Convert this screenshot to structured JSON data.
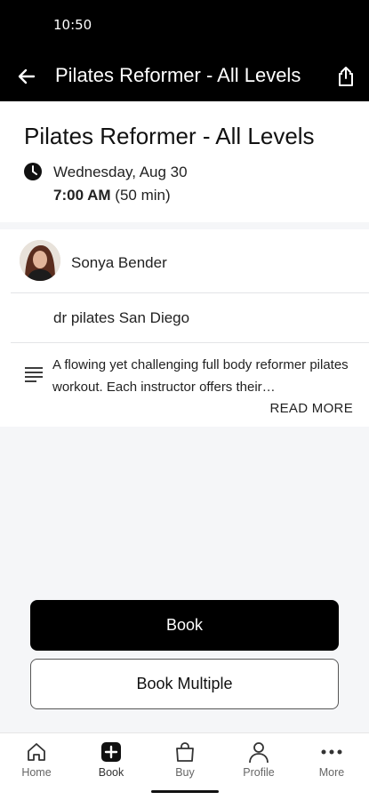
{
  "status_bar": {
    "time": "10:50"
  },
  "app_bar": {
    "title": "Pilates Reformer - All Levels",
    "back_icon": "arrow-left-icon",
    "share_icon": "share-icon"
  },
  "class": {
    "title": "Pilates Reformer - All Levels",
    "date": "Wednesday, Aug 30",
    "start_time": "7:00 AM",
    "duration": "(50 min)"
  },
  "instructor": {
    "name": "Sonya Bender",
    "avatar_icon": "avatar-photo"
  },
  "studio": {
    "name": "dr pilates San Diego"
  },
  "description": {
    "text": "A flowing yet challenging full body reformer pilates workout. Each instructor offers their…",
    "read_more": "READ MORE"
  },
  "actions": {
    "book": "Book",
    "book_multiple": "Book Multiple"
  },
  "bottom_nav": {
    "items": [
      {
        "label": "Home",
        "icon": "home-icon"
      },
      {
        "label": "Book",
        "icon": "plus-square-icon"
      },
      {
        "label": "Buy",
        "icon": "shopping-bag-icon"
      },
      {
        "label": "Profile",
        "icon": "person-icon"
      },
      {
        "label": "More",
        "icon": "more-dots-icon"
      }
    ]
  },
  "colors": {
    "header_bg": "#000000",
    "primary_button": "#000000",
    "page_bg": "#f5f6f8"
  }
}
